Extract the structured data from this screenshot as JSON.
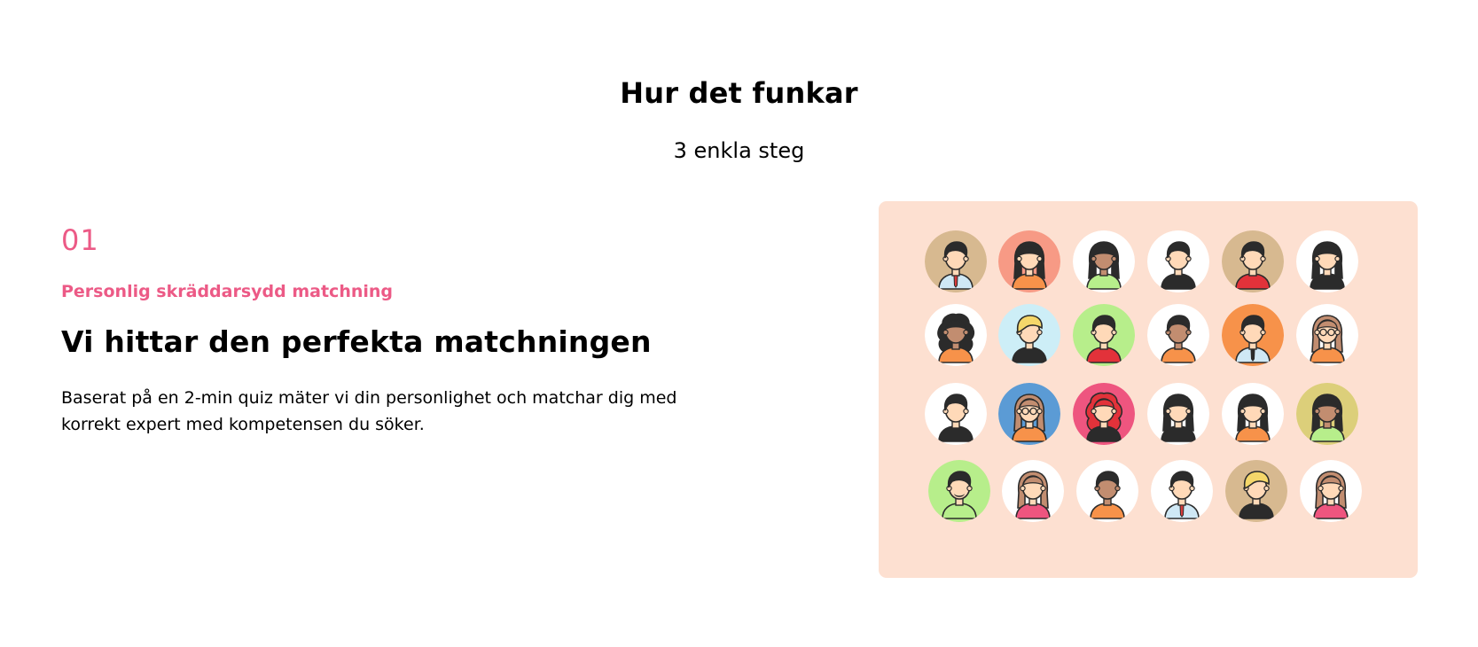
{
  "header": {
    "title": "Hur det funkar",
    "subtitle": "3 enkla steg"
  },
  "step": {
    "number": "01",
    "kicker": "Personlig skräddarsydd matchning",
    "heading": "Vi hittar den perfekta matchningen",
    "body": "Baserat på en 2-min quiz mäter vi din personlighet och matchar dig med korrekt expert med kompetensen du söker."
  },
  "avatars": [
    {
      "bg": "#d7b990",
      "skin": "#ffd9b8",
      "hair": "#2b2b2b",
      "shirt": "#cfe8f5",
      "style": "short",
      "tie": "#d73c3c"
    },
    {
      "bg": "#f79a85",
      "skin": "#ffd9b8",
      "hair": "#2b2b2b",
      "shirt": "#f7924a",
      "style": "long"
    },
    {
      "bg": "#ffffff",
      "skin": "#c28d70",
      "hair": "#2b2b2b",
      "shirt": "#b7ee8b",
      "style": "long"
    },
    {
      "bg": "#ffffff",
      "skin": "#ffd9b8",
      "hair": "#2b2b2b",
      "shirt": "#2b2b2b",
      "style": "short"
    },
    {
      "bg": "#d7b990",
      "skin": "#ffd9b8",
      "hair": "#2b2b2b",
      "shirt": "#e2323a",
      "style": "short"
    },
    {
      "bg": "#ffffff",
      "skin": "#ffd9b8",
      "hair": "#2b2b2b",
      "shirt": "#2b2b2b",
      "style": "long"
    },
    {
      "bg": "#ffffff",
      "skin": "#c28d70",
      "hair": "#2b2b2b",
      "shirt": "#f7924a",
      "style": "curly"
    },
    {
      "bg": "#cdeef7",
      "skin": "#ffd9b8",
      "hair": "#f5d76a",
      "shirt": "#2b2b2b",
      "style": "side"
    },
    {
      "bg": "#b7ee8b",
      "skin": "#ffd9b8",
      "hair": "#2b2b2b",
      "shirt": "#e2323a",
      "style": "short"
    },
    {
      "bg": "#ffffff",
      "skin": "#c28d70",
      "hair": "#2b2b2b",
      "shirt": "#f7924a",
      "style": "short"
    },
    {
      "bg": "#f7924a",
      "skin": "#ffd9b8",
      "hair": "#2b2b2b",
      "shirt": "#cfe8f5",
      "style": "short",
      "tie": "#2b2b2b"
    },
    {
      "bg": "#ffffff",
      "skin": "#ffd9b8",
      "hair": "#c28d70",
      "shirt": "#f7924a",
      "style": "long",
      "glasses": true
    },
    {
      "bg": "#ffffff",
      "skin": "#ffd9b8",
      "hair": "#2b2b2b",
      "shirt": "#2b2b2b",
      "style": "short"
    },
    {
      "bg": "#5b9bd5",
      "skin": "#ffd9b8",
      "hair": "#c28d70",
      "shirt": "#f7924a",
      "style": "long",
      "glasses": true
    },
    {
      "bg": "#ee557f",
      "skin": "#ffd9b8",
      "hair": "#e2323a",
      "shirt": "#2b2b2b",
      "style": "curly"
    },
    {
      "bg": "#ffffff",
      "skin": "#ffd9b8",
      "hair": "#2b2b2b",
      "shirt": "#2b2b2b",
      "style": "long"
    },
    {
      "bg": "#ffffff",
      "skin": "#ffd9b8",
      "hair": "#2b2b2b",
      "shirt": "#f7924a",
      "style": "long"
    },
    {
      "bg": "#dccf7a",
      "skin": "#c28d70",
      "hair": "#2b2b2b",
      "shirt": "#b7ee8b",
      "style": "long"
    },
    {
      "bg": "#b7ee8b",
      "skin": "#ffd9b8",
      "hair": "#2b2b2b",
      "shirt": "#b7ee8b",
      "style": "short",
      "beard": true
    },
    {
      "bg": "#ffffff",
      "skin": "#ffd9b8",
      "hair": "#c28d70",
      "shirt": "#ee557f",
      "style": "long"
    },
    {
      "bg": "#ffffff",
      "skin": "#c28d70",
      "hair": "#2b2b2b",
      "shirt": "#f7924a",
      "style": "short"
    },
    {
      "bg": "#ffffff",
      "skin": "#ffd9b8",
      "hair": "#2b2b2b",
      "shirt": "#cfe8f5",
      "style": "short",
      "tie": "#d73c3c"
    },
    {
      "bg": "#d7b990",
      "skin": "#ffd9b8",
      "hair": "#f5d76a",
      "shirt": "#2b2b2b",
      "style": "side"
    },
    {
      "bg": "#ffffff",
      "skin": "#ffd9b8",
      "hair": "#c28d70",
      "shirt": "#ee557f",
      "style": "long"
    }
  ]
}
